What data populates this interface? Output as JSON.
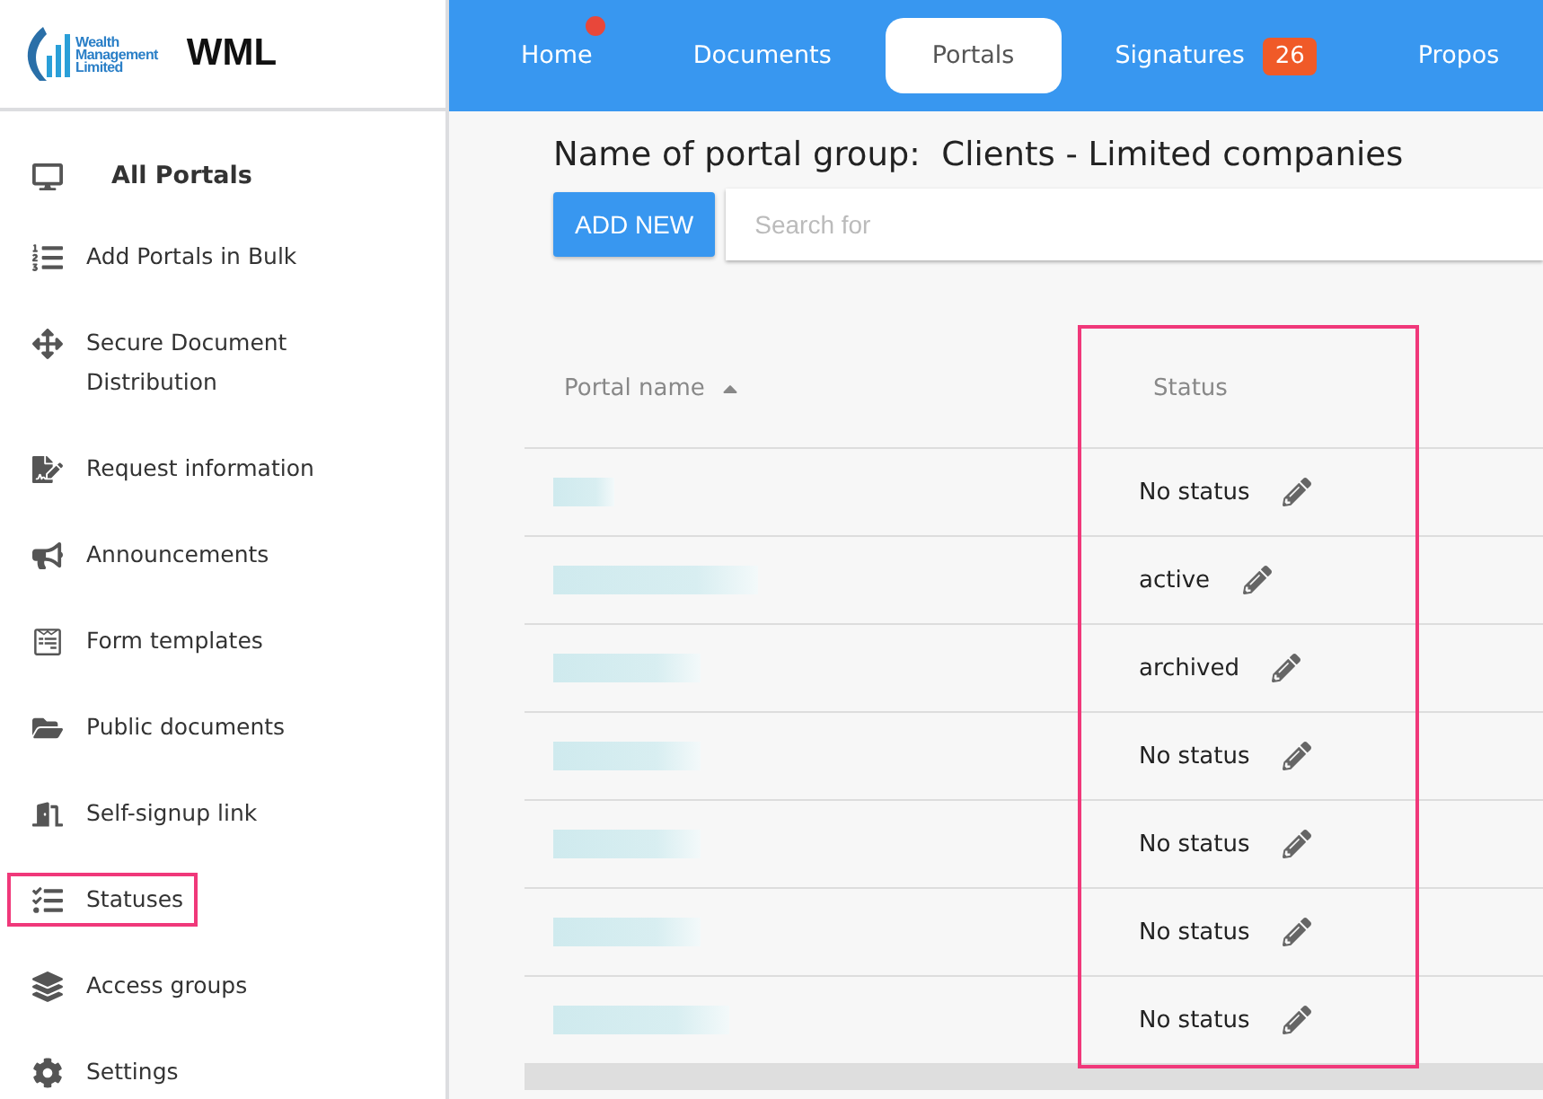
{
  "header": {
    "logo_lines": [
      "Wealth",
      "Management",
      "Limited"
    ],
    "brand": "WML"
  },
  "nav": {
    "tabs": [
      {
        "label": "Home",
        "selected": false,
        "dot": true
      },
      {
        "label": "Documents",
        "selected": false,
        "dot": false
      },
      {
        "label": "Portals",
        "selected": true,
        "dot": false
      },
      {
        "label": "Signatures",
        "selected": false,
        "dot": false,
        "badge": "26"
      },
      {
        "label": "Propos",
        "selected": false,
        "dot": false
      }
    ]
  },
  "sidebar": {
    "items": [
      {
        "label": "All Portals",
        "kind": "heading",
        "highlighted": false
      },
      {
        "label": "Add Portals in Bulk",
        "kind": "link",
        "highlighted": false
      },
      {
        "label": "Secure Document Distribution",
        "kind": "link",
        "highlighted": false
      },
      {
        "label": "Request information",
        "kind": "link",
        "highlighted": false
      },
      {
        "label": "Announcements",
        "kind": "link",
        "highlighted": false
      },
      {
        "label": "Form templates",
        "kind": "link",
        "highlighted": false
      },
      {
        "label": "Public documents",
        "kind": "link",
        "highlighted": false
      },
      {
        "label": "Self-signup link",
        "kind": "link",
        "highlighted": false
      },
      {
        "label": "Statuses",
        "kind": "link",
        "highlighted": true
      },
      {
        "label": "Access groups",
        "kind": "link",
        "highlighted": false
      },
      {
        "label": "Settings",
        "kind": "link",
        "highlighted": false
      }
    ]
  },
  "page": {
    "title": "Name of portal group:  Clients - Limited companies",
    "add_button": "ADD NEW",
    "search": {
      "placeholder": "Search for"
    }
  },
  "table": {
    "columns": [
      {
        "label": "Portal name",
        "sort_ascending": true,
        "highlighted": false
      },
      {
        "label": "Status",
        "sort_ascending": false,
        "highlighted": true
      }
    ],
    "rows": [
      {
        "status": "No status"
      },
      {
        "status": "active"
      },
      {
        "status": "archived"
      },
      {
        "status": "No status"
      },
      {
        "status": "No status"
      },
      {
        "status": "No status"
      },
      {
        "status": "No status"
      }
    ]
  }
}
